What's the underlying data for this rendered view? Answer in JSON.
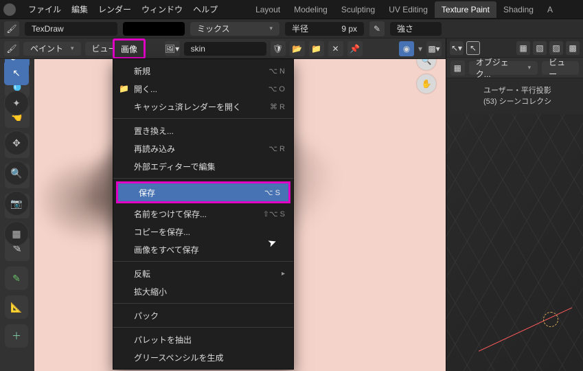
{
  "menubar": {
    "file": "ファイル",
    "edit": "編集",
    "render": "レンダー",
    "window": "ウィンドウ",
    "help": "ヘルプ"
  },
  "tabs": {
    "layout": "Layout",
    "modeling": "Modeling",
    "sculpting": "Sculpting",
    "uv": "UV Editing",
    "texture": "Texture Paint",
    "shading": "Shading",
    "a": "A"
  },
  "toolbar": {
    "texdraw": "TexDraw",
    "blend": "ミックス",
    "radius_label": "半径",
    "radius_value": "9 px",
    "strength_label": "強さ"
  },
  "toolbar2": {
    "mode": "ペイント",
    "view": "ビュー",
    "image": "画像",
    "texname": "skin",
    "select_arrow": "▾"
  },
  "image_menu": {
    "new": "新規",
    "new_sc": "⌥ N",
    "open": "開く...",
    "open_sc": "⌥ O",
    "open_cached": "キャッシュ済レンダーを開く",
    "open_cached_sc": "⌘ R",
    "replace": "置き換え...",
    "reload": "再読み込み",
    "reload_sc": "⌥ R",
    "edit_ext": "外部エディターで編集",
    "save": "保存",
    "save_sc": "⌥ S",
    "save_as": "名前をつけて保存...",
    "save_as_sc": "⇧⌥ S",
    "save_copy": "コピーを保存...",
    "save_all": "画像をすべて保存",
    "invert": "反転",
    "resize": "拡大縮小",
    "pack": "パック",
    "extract_palette": "パレットを抽出",
    "gen_gp": "グリースペンシルを生成"
  },
  "right": {
    "object_mode": "オブジェク...",
    "view": "ビュー",
    "proj": "ユーザー・平行投影",
    "scene": "(53) シーンコレクシ"
  }
}
